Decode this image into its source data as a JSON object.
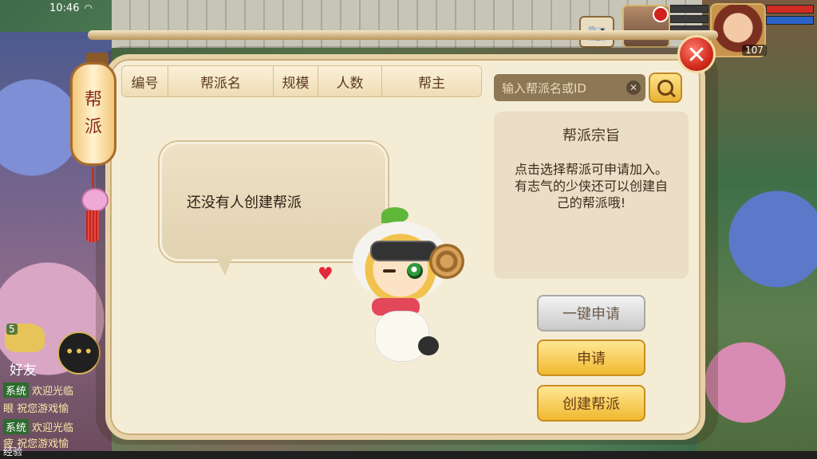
{
  "status_bar": {
    "time": "10:46"
  },
  "hud": {
    "player_level": "107",
    "camera_icon": "camera-icon",
    "hp_color": "#d12c23",
    "mp_color": "#2b62c9"
  },
  "chat": {
    "emote_badge": "5",
    "friends_label": "好友",
    "lines": [
      {
        "tag": "系统",
        "text": "欢迎光临"
      },
      {
        "tag": "",
        "text": "眼 祝您游戏愉"
      },
      {
        "tag": "系统",
        "text": "欢迎光临"
      },
      {
        "tag": "",
        "text": "疲 祝您游戏愉"
      }
    ],
    "exp_label": "经验"
  },
  "panel": {
    "lantern_text": [
      "帮",
      "派"
    ],
    "close_label": "✕",
    "table_headers": [
      "编号",
      "帮派名",
      "规模",
      "人数",
      "帮主"
    ],
    "search": {
      "placeholder": "输入帮派名或ID",
      "value": ""
    },
    "empty_message": "还没有人创建帮派",
    "info": {
      "title": "帮派宗旨",
      "body": "点击选择帮派可申请加入。有志气的少侠还可以创建自己的帮派哦!"
    },
    "buttons": {
      "one_key_apply": "一键申请",
      "apply": "申请",
      "create": "创建帮派"
    }
  },
  "colors": {
    "accent_gold": "#f0c14a",
    "panel_bg": "#f5ecd6",
    "close_red": "#d12b1c"
  }
}
